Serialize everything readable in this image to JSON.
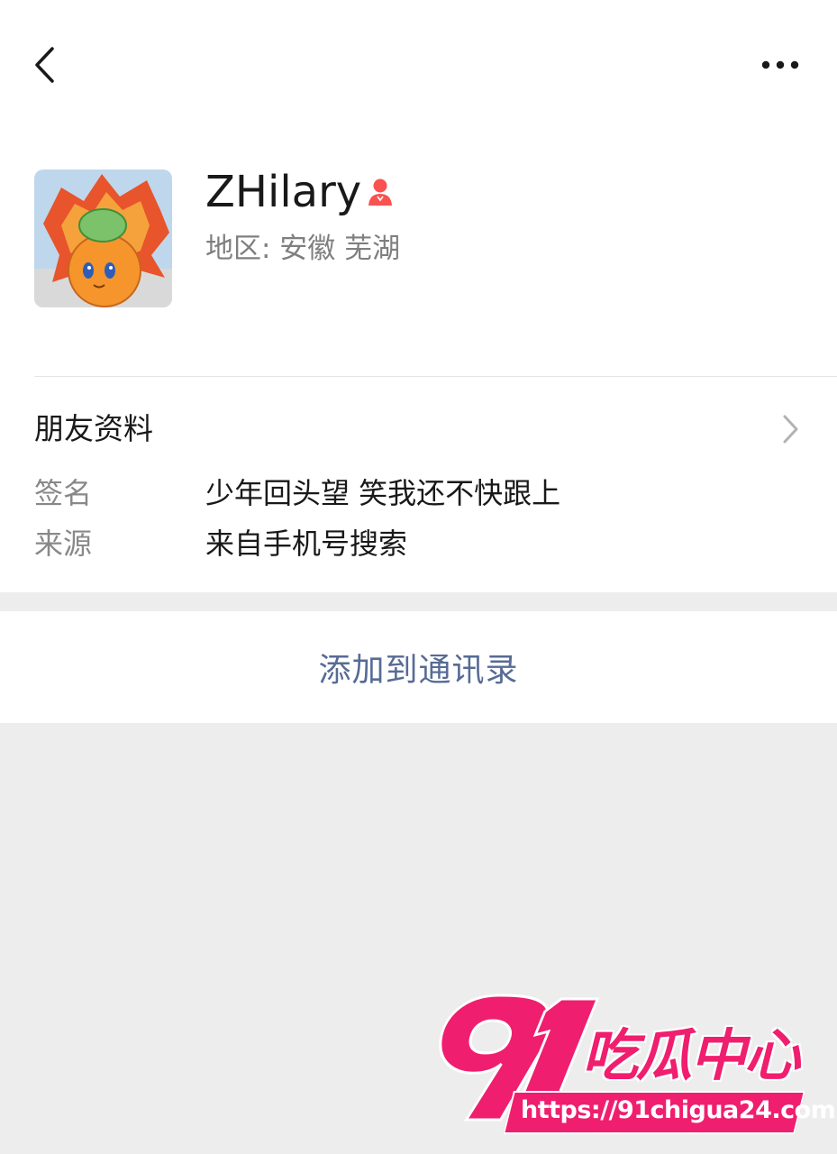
{
  "profile": {
    "name": "ZHilary",
    "region": "地区: 安徽 芜湖",
    "gender_icon": "female-icon",
    "gender_color": "#fa5151"
  },
  "friend_info": {
    "title": "朋友资料",
    "rows": [
      {
        "label": "签名",
        "value": "少年回头望 笑我还不快跟上"
      },
      {
        "label": "来源",
        "value": "来自手机号搜索"
      }
    ]
  },
  "actions": {
    "add_to_contacts": "添加到通讯录"
  },
  "icons": {
    "back": "back-arrow-icon",
    "more": "more-icon",
    "chevron": "chevron-right-icon"
  },
  "colors": {
    "link": "#576b95",
    "background": "#ededed",
    "watermark": "#f01e6e"
  },
  "watermark": {
    "logo_number": "91",
    "logo_text": "吃瓜中心",
    "url": "https://91chigua24.com"
  }
}
